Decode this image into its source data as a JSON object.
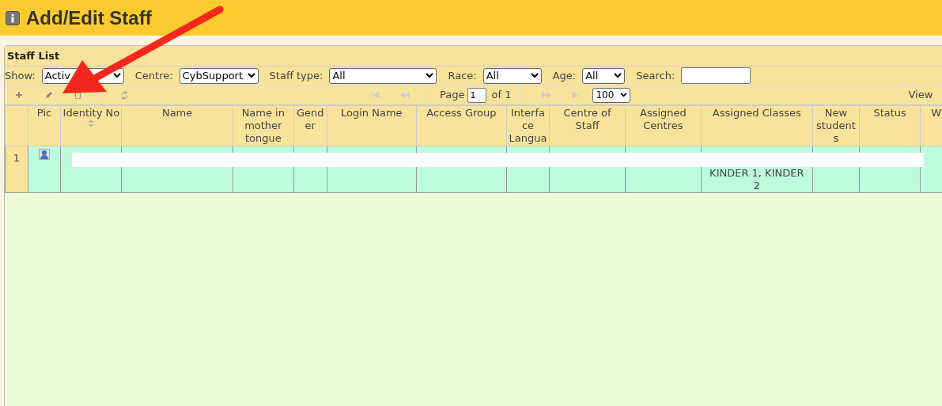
{
  "page": {
    "title": "Add/Edit Staff"
  },
  "panel": {
    "title": "Staff List"
  },
  "filters": [
    {
      "label": "Show:",
      "kind": "select",
      "value": "Activ"
    },
    {
      "label": "Centre:",
      "kind": "select",
      "value": "CybSupport"
    },
    {
      "label": "Staff type:",
      "kind": "select",
      "value": "All"
    },
    {
      "label": "Race:",
      "kind": "select",
      "value": "All"
    },
    {
      "label": "Age:",
      "kind": "select",
      "value": "All"
    },
    {
      "label": "Search:",
      "kind": "input"
    }
  ],
  "pager": {
    "page_label": "Page",
    "page": "1",
    "of": "of 1",
    "page_size": "100",
    "view": "View"
  },
  "table": {
    "columns": [
      "Pic",
      "Identity No",
      "Name",
      "Name in mother tongue",
      "Gender",
      "Login Name",
      "Access Group",
      "Interface Langua",
      "Centre of Staff",
      "Assigned Centres",
      "Assigned Classes",
      "New students",
      "Status",
      "W"
    ],
    "rows": [
      {
        "number": "1",
        "assigned_classes": "KINDER 1, KINDER 2"
      }
    ]
  }
}
